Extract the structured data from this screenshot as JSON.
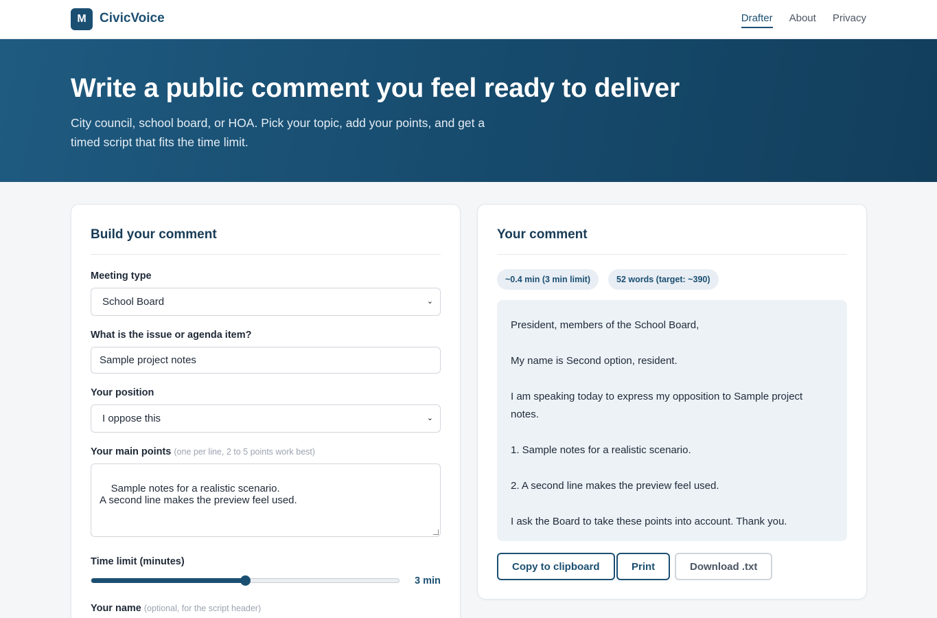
{
  "nav": {
    "logo_letter": "M",
    "brand": "CivicVoice",
    "links": [
      "Drafter",
      "About",
      "Privacy"
    ]
  },
  "hero": {
    "title": "Write a public comment you feel ready to deliver",
    "subtitle": "City council, school board, or HOA. Pick your topic, add your points, and get a timed script that fits the time limit."
  },
  "form": {
    "title": "Build your comment",
    "meeting_type": {
      "label": "Meeting type",
      "value": "School Board"
    },
    "issue": {
      "label": "What is the issue or agenda item?",
      "value": "Sample project notes"
    },
    "position": {
      "label": "Your position",
      "value": "I oppose this"
    },
    "points": {
      "label": "Your main points",
      "hint": "(one per line, 2 to 5 points work best)",
      "value": "Sample notes for a realistic scenario.\nA second line makes the preview feel used."
    },
    "time_limit": {
      "label": "Time limit (minutes)",
      "value_text": "3 min",
      "fraction": 0.5
    },
    "name": {
      "label": "Your name",
      "hint": "(optional, for the script header)"
    }
  },
  "output": {
    "title": "Your comment",
    "duration_pill": "~0.4 min (3 min limit)",
    "words_pill": "52 words (target: ~390)",
    "paragraphs": [
      "President, members of the School Board,",
      "My name is Second option, resident.",
      "I am speaking today to express my opposition to Sample project notes.",
      "1. Sample notes for a realistic scenario.",
      "2. A second line makes the preview feel used.",
      "I ask the Board to take these points into account. Thank you."
    ],
    "copy_label": "Copy to clipboard",
    "print_label": "Print",
    "download_label": "Download .txt"
  },
  "colors": {
    "brand": "#1b4f72",
    "hero_bg": "#164a6c",
    "page_bg": "#f4f6f8",
    "preview_bg": "#edf2f7"
  }
}
